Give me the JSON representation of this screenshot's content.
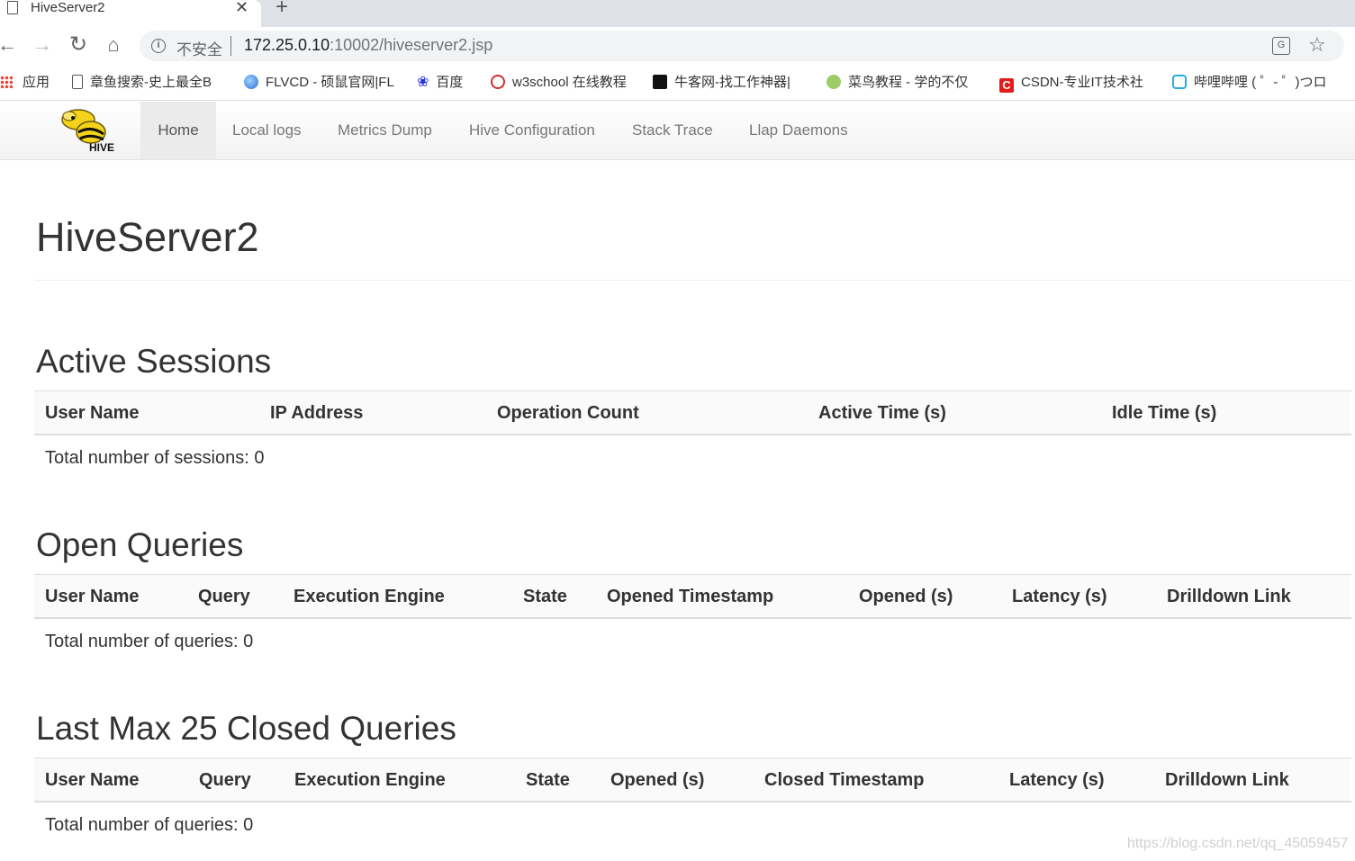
{
  "browser": {
    "tab_title": "HiveServer2",
    "security_label": "不安全",
    "url_host": "172.25.0.10",
    "url_rest": ":10002/hiveserver2.jsp"
  },
  "bookmarks": [
    {
      "label": "应用",
      "icon": "apps-icon"
    },
    {
      "label": "章鱼搜索-史上最全B",
      "icon": "page-icon"
    },
    {
      "label": "FLVCD - 硕鼠官网|FL",
      "icon": "globe-icon"
    },
    {
      "label": "百度",
      "icon": "baidu-paw-icon"
    },
    {
      "label": "w3school 在线教程",
      "icon": "w3school-icon"
    },
    {
      "label": "牛客网-找工作神器|",
      "icon": "nowcoder-icon"
    },
    {
      "label": "菜鸟教程 - 学的不仅",
      "icon": "runoob-icon"
    },
    {
      "label": "CSDN-专业IT技术社",
      "icon": "csdn-icon"
    },
    {
      "label": "哔哩哔哩 ( ゜- ゜)つロ",
      "icon": "bilibili-icon"
    }
  ],
  "navbar": {
    "logo_text": "HIVE",
    "items": [
      "Home",
      "Local logs",
      "Metrics Dump",
      "Hive Configuration",
      "Stack Trace",
      "Llap Daemons"
    ],
    "active": "Home"
  },
  "page": {
    "title": "HiveServer2"
  },
  "active_sessions": {
    "title": "Active Sessions",
    "columns": [
      "User Name",
      "IP Address",
      "Operation Count",
      "Active Time (s)",
      "Idle Time (s)"
    ],
    "total_text": "Total number of sessions: 0"
  },
  "open_queries": {
    "title": "Open Queries",
    "columns": [
      "User Name",
      "Query",
      "Execution Engine",
      "State",
      "Opened Timestamp",
      "Opened (s)",
      "Latency (s)",
      "Drilldown Link"
    ],
    "total_text": "Total number of queries: 0"
  },
  "closed_queries": {
    "title": "Last Max 25 Closed Queries",
    "columns": [
      "User Name",
      "Query",
      "Execution Engine",
      "State",
      "Opened (s)",
      "Closed Timestamp",
      "Latency (s)",
      "Drilldown Link"
    ],
    "total_text": "Total number of queries: 0"
  },
  "watermark": "https://blog.csdn.net/qq_45059457"
}
